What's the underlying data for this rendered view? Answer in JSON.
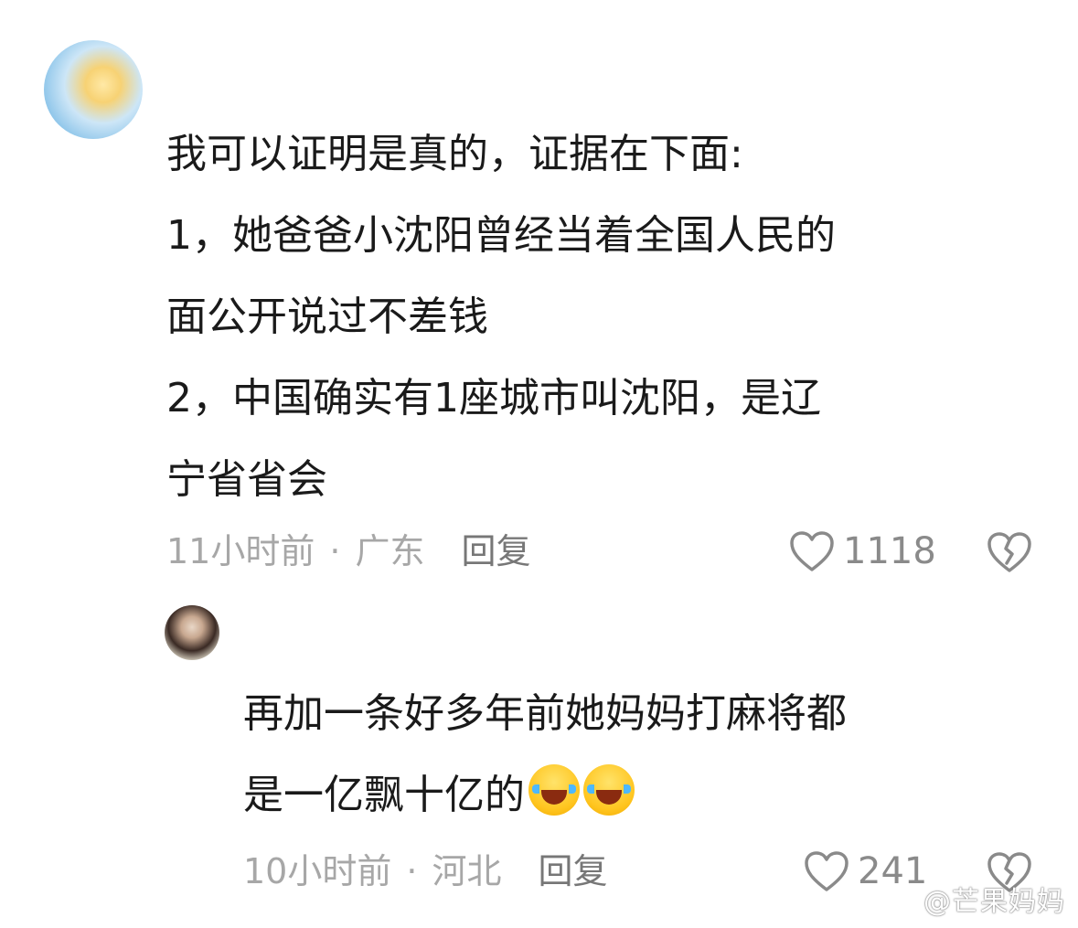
{
  "comment": {
    "lines": [
      "我可以证明是真的，证据在下面:",
      "1，她爸爸小沈阳曾经当着全国人民的",
      "面公开说过不差钱",
      "2，中国确实有1座城市叫沈阳，是辽",
      "宁省省会"
    ],
    "time": "11小时前",
    "separator": "·",
    "location": "广东",
    "reply_label": "回复",
    "likes": "1118",
    "accent_color": "#8a8a8a"
  },
  "reply": {
    "lines": [
      "再加一条好多年前她妈妈打麻将都",
      "是一亿飘十亿的"
    ],
    "emojis": [
      "laughing-crying-emoji",
      "laughing-crying-emoji"
    ],
    "time": "10小时前",
    "separator": "·",
    "location": "河北",
    "reply_label": "回复",
    "likes": "241"
  },
  "watermark": "@芒果妈妈"
}
